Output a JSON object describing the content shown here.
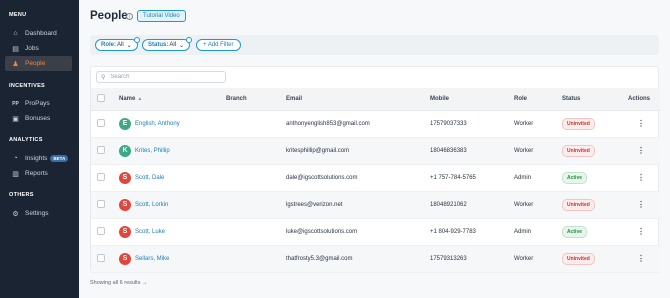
{
  "sidebar": {
    "sections": [
      {
        "label": "MENU"
      },
      {
        "label": "INCENTIVES"
      },
      {
        "label": "ANALYTICS"
      },
      {
        "label": "OTHERS"
      }
    ],
    "items": [
      {
        "label": "Dashboard",
        "icon": "dashboard-icon",
        "glyph": "⌂"
      },
      {
        "label": "Jobs",
        "icon": "briefcase-icon",
        "glyph": "▤"
      },
      {
        "label": "People",
        "icon": "people-icon",
        "glyph": "♟",
        "active": true
      },
      {
        "label": "ProPays",
        "icon": "propays-icon",
        "glyph": "PP"
      },
      {
        "label": "Bonuses",
        "icon": "bonus-icon",
        "glyph": "▣"
      },
      {
        "label": "Insights",
        "icon": "insights-icon",
        "glyph": "◔",
        "badge": "BETA"
      },
      {
        "label": "Reports",
        "icon": "reports-icon",
        "glyph": "▥"
      },
      {
        "label": "Settings",
        "icon": "gear-icon",
        "glyph": "⚙"
      }
    ]
  },
  "header": {
    "title": "People",
    "info_icon": "info-icon",
    "tutorial_label": "Tutorial Video"
  },
  "filters": {
    "role": {
      "key": "Role:",
      "value": "All"
    },
    "status": {
      "key": "Status:",
      "value": "All"
    },
    "add_label": "+ Add Filter"
  },
  "search": {
    "placeholder": "Search",
    "value": ""
  },
  "table": {
    "columns": [
      "Name",
      "Branch",
      "Email",
      "Mobile",
      "Role",
      "Status",
      "Actions"
    ],
    "rows": [
      {
        "initial": "E",
        "name": "English, Anthony",
        "branch": "",
        "email": "anthonyenglish853@gmail.com",
        "mobile": "17579037333",
        "role": "Worker",
        "status": "Uninvited"
      },
      {
        "initial": "K",
        "name": "Krites, Phillip",
        "branch": "",
        "email": "kritesphillip@gmail.com",
        "mobile": "18046836383",
        "role": "Worker",
        "status": "Uninvited"
      },
      {
        "initial": "S",
        "name": "Scott, Dale",
        "branch": "",
        "email": "dale@igscottsolutions.com",
        "mobile": "+1 757-784-5765",
        "role": "Admin",
        "status": "Active"
      },
      {
        "initial": "S",
        "name": "Scott, Lorkin",
        "branch": "",
        "email": "lgstrees@verizon.net",
        "mobile": "18048921062",
        "role": "Worker",
        "status": "Uninvited"
      },
      {
        "initial": "S",
        "name": "Scott, Luke",
        "branch": "",
        "email": "luke@igscottsolutions.com",
        "mobile": "+1 804-929-7783",
        "role": "Admin",
        "status": "Active"
      },
      {
        "initial": "S",
        "name": "Sellars, Mike",
        "branch": "",
        "email": "thatfrosty5.3@gmail.com",
        "mobile": "17579313263",
        "role": "Worker",
        "status": "Uninvited"
      }
    ]
  },
  "footer": {
    "label": "Showing all 6 results →"
  },
  "colors": {
    "sidebar_bg": "#1b2432",
    "accent": "#1b9ad6",
    "active_nav": "#f0883e",
    "avatar_green": "#3aaa82",
    "avatar_red": "#e2453c"
  }
}
